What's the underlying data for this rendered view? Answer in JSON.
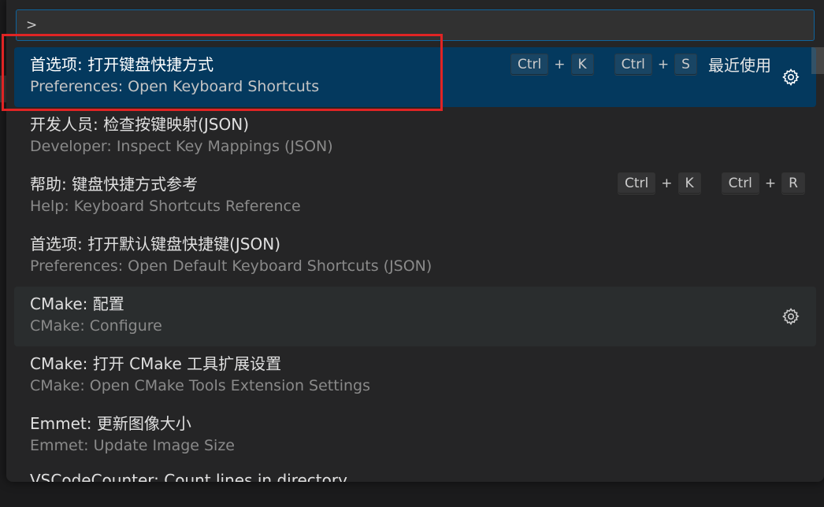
{
  "palette": {
    "input_value": ">",
    "items": [
      {
        "label": "首选项: 打开键盘快捷方式",
        "detail": "Preferences: Open Keyboard Shortcuts",
        "keybinding": [
          [
            "Ctrl",
            "K"
          ],
          [
            "Ctrl",
            "S"
          ]
        ],
        "recent_label": "最近使用",
        "selected": true
      },
      {
        "label": "开发人员: 检查按键映射(JSON)",
        "detail": "Developer: Inspect Key Mappings (JSON)"
      },
      {
        "label": "帮助: 键盘快捷方式参考",
        "detail": "Help: Keyboard Shortcuts Reference",
        "keybinding": [
          [
            "Ctrl",
            "K"
          ],
          [
            "Ctrl",
            "R"
          ]
        ]
      },
      {
        "label": "首选项: 打开默认键盘快捷键(JSON)",
        "detail": "Preferences: Open Default Keyboard Shortcuts (JSON)"
      },
      {
        "label": "CMake: 配置",
        "detail": "CMake: Configure",
        "hover": true
      },
      {
        "label": "CMake: 打开 CMake 工具扩展设置",
        "detail": "CMake: Open CMake Tools Extension Settings"
      },
      {
        "label": "Emmet: 更新图像大小",
        "detail": "Emmet: Update Image Size"
      },
      {
        "label": "VSCodeCounter: Count lines in directory",
        "detail": ""
      }
    ],
    "plus_sign": "+"
  },
  "colors": {
    "selected_bg": "#04395e",
    "hover_bg": "#2a2d2e",
    "annotation": "#e02424",
    "focus_border": "#0e639c"
  },
  "icons": {
    "configure": "gear-icon"
  }
}
